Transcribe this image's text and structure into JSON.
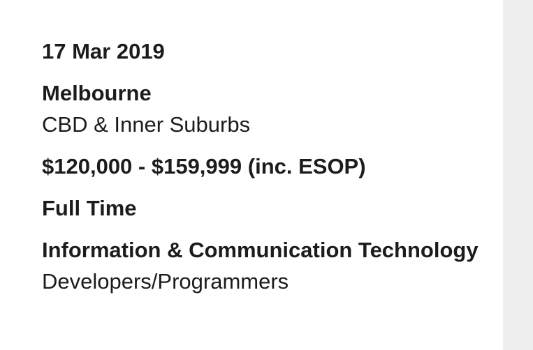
{
  "job": {
    "listed_date": "17 Mar 2019",
    "location": "Melbourne",
    "area": "CBD & Inner Suburbs",
    "salary": "$120,000 - $159,999 (inc. ESOP)",
    "work_type": "Full Time",
    "classification": "Information & Communication Technology",
    "sub_classification": "Developers/Programmers"
  },
  "colors": {
    "text": "#1c1c1c",
    "side_panel": "#eeeeee"
  }
}
